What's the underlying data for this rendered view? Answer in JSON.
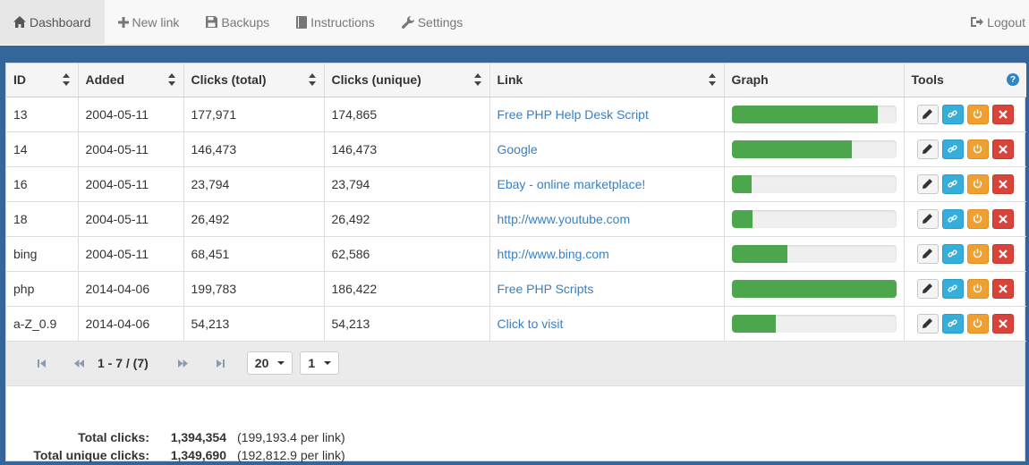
{
  "nav": {
    "items": [
      {
        "label": "Dashboard",
        "icon": "home-icon",
        "active": true
      },
      {
        "label": "New link",
        "icon": "plus-icon",
        "active": false
      },
      {
        "label": "Backups",
        "icon": "floppy-icon",
        "active": false
      },
      {
        "label": "Instructions",
        "icon": "book-icon",
        "active": false
      },
      {
        "label": "Settings",
        "icon": "wrench-icon",
        "active": false
      }
    ],
    "logout": {
      "label": "Logout",
      "icon": "logout-icon"
    }
  },
  "table": {
    "headers": {
      "id": "ID",
      "added": "Added",
      "clicks_total": "Clicks (total)",
      "clicks_unique": "Clicks (unique)",
      "link": "Link",
      "graph": "Graph",
      "tools": "Tools"
    },
    "help_glyph": "?",
    "rows": [
      {
        "id": "13",
        "added": "2004-05-11",
        "clicks_total": "177,971",
        "clicks_unique": "174,865",
        "link": "Free PHP Help Desk Script",
        "graph": 0.89
      },
      {
        "id": "14",
        "added": "2004-05-11",
        "clicks_total": "146,473",
        "clicks_unique": "146,473",
        "link": "Google",
        "graph": 0.73
      },
      {
        "id": "16",
        "added": "2004-05-11",
        "clicks_total": "23,794",
        "clicks_unique": "23,794",
        "link": "Ebay - online marketplace!",
        "graph": 0.12
      },
      {
        "id": "18",
        "added": "2004-05-11",
        "clicks_total": "26,492",
        "clicks_unique": "26,492",
        "link": "http://www.youtube.com",
        "graph": 0.13
      },
      {
        "id": "bing",
        "added": "2004-05-11",
        "clicks_total": "68,451",
        "clicks_unique": "62,586",
        "link": "http://www.bing.com",
        "graph": 0.34
      },
      {
        "id": "php",
        "added": "2014-04-06",
        "clicks_total": "199,783",
        "clicks_unique": "186,422",
        "link": "Free PHP Scripts",
        "graph": 1.0
      },
      {
        "id": "a-Z_0.9",
        "added": "2014-04-06",
        "clicks_total": "54,213",
        "clicks_unique": "54,213",
        "link": "Click to visit",
        "graph": 0.27
      }
    ]
  },
  "pager": {
    "info": "1 - 7 / (7)",
    "page_size": "20",
    "page": "1"
  },
  "totals": {
    "total_label": "Total clicks:",
    "total_value": "1,394,354",
    "total_per": "(199,193.4 per link)",
    "unique_label": "Total unique clicks:",
    "unique_value": "1,349,690",
    "unique_per": "(192,812.9 per link)"
  },
  "colors": {
    "frame": "#336699",
    "bar": "#4ca64c",
    "link": "#3a80c2"
  }
}
